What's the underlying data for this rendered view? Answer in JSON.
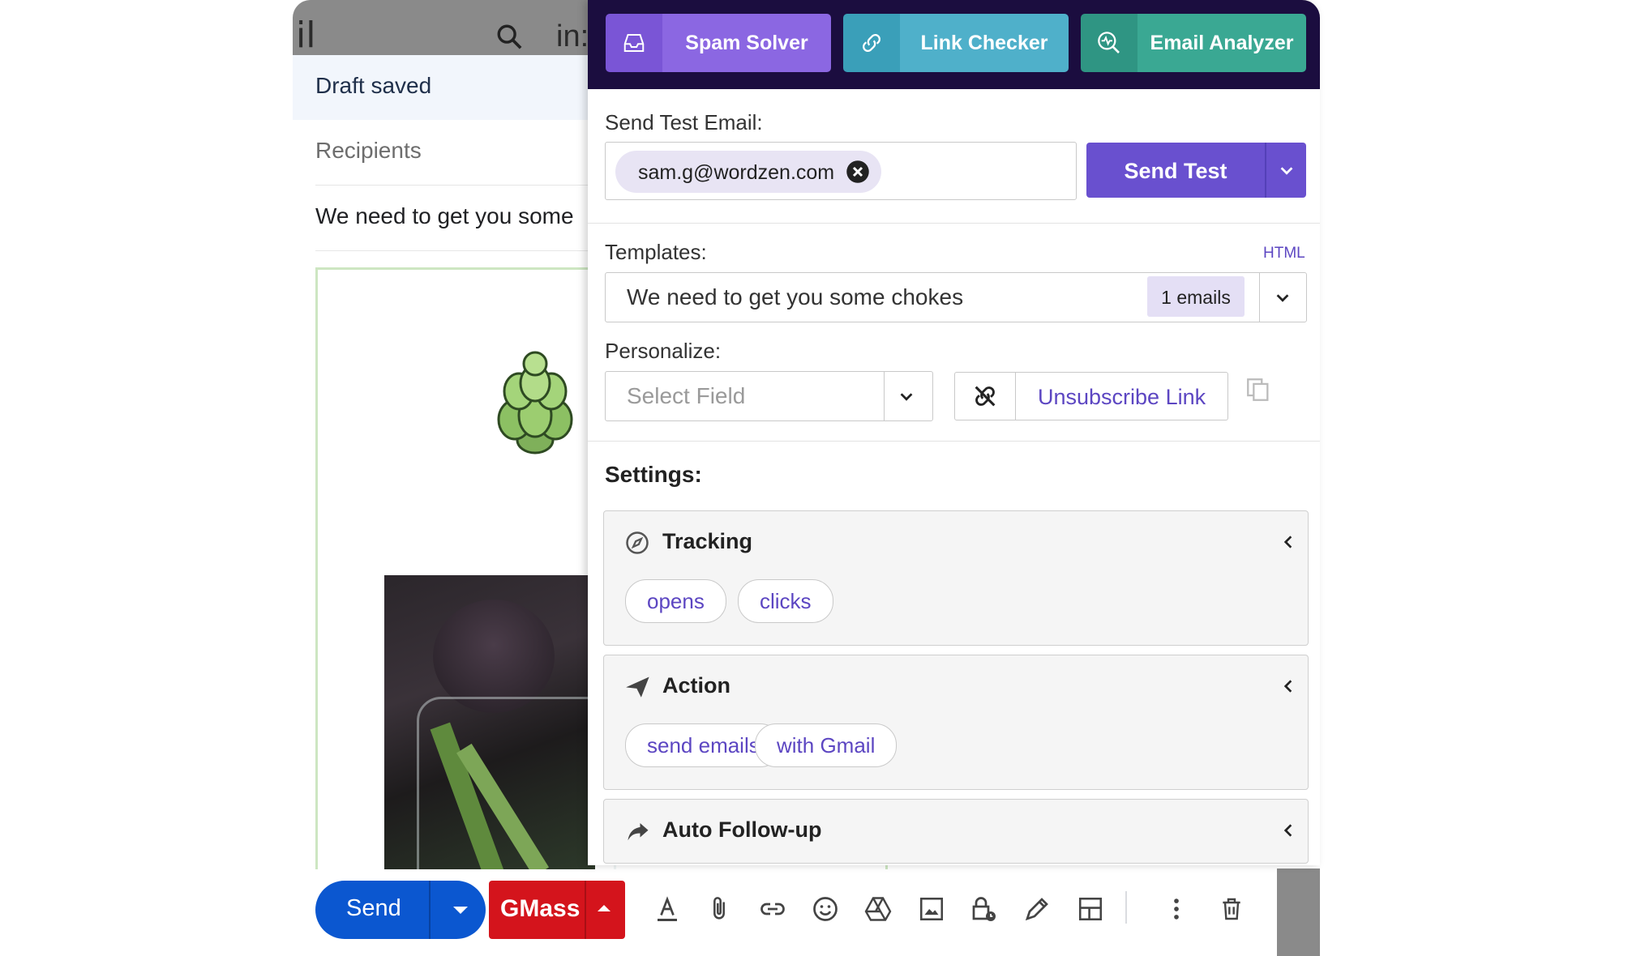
{
  "compose": {
    "topbar_fragment": "il",
    "search_fragment": "in:",
    "draft_status": "Draft saved",
    "recipients_placeholder": "Recipients",
    "subject": "We need to get you some",
    "send_label": "Send",
    "gmass_label": "GMass"
  },
  "toolbar_icons": [
    "format-text-icon",
    "attach-icon",
    "link-icon",
    "emoji-icon",
    "drive-icon",
    "photo-icon",
    "confidential-lock-icon",
    "signature-pen-icon",
    "layout-template-icon",
    "more-options-icon",
    "trash-icon"
  ],
  "panel": {
    "header_buttons": [
      {
        "label": "Spam Solver",
        "icon": "inbox-icon"
      },
      {
        "label": "Link Checker",
        "icon": "link-chain-icon"
      },
      {
        "label": "Email Analyzer",
        "icon": "analyze-magnifier-icon"
      }
    ],
    "send_test": {
      "label": "Send Test Email:",
      "email_chip": "sam.g@wordzen.com",
      "button_label": "Send Test"
    },
    "templates": {
      "label": "Templates:",
      "html_link": "HTML",
      "selected": "We need to get you some chokes",
      "count_badge": "1 emails"
    },
    "personalize": {
      "label": "Personalize:",
      "field_placeholder": "Select Field",
      "unsubscribe_label": "Unsubscribe Link"
    },
    "settings": {
      "label": "Settings:",
      "cards": [
        {
          "title": "Tracking",
          "icon": "compass-icon",
          "pills": [
            "opens",
            "clicks"
          ]
        },
        {
          "title": "Action",
          "icon": "paper-plane-icon",
          "pills": [
            "send emails",
            "with Gmail"
          ]
        },
        {
          "title": "Auto Follow-up",
          "icon": "forward-arrow-icon",
          "pills": []
        }
      ]
    }
  },
  "colors": {
    "panel_header_bg": "#1b0d3f",
    "spam_solver": "#8b67e2",
    "link_checker": "#4fb0ca",
    "email_analyzer": "#3aa893",
    "send_test_button": "#6950cf",
    "gmail_send": "#0b57d0",
    "gmass_button": "#d4141c",
    "accent_text": "#5c46c2"
  }
}
